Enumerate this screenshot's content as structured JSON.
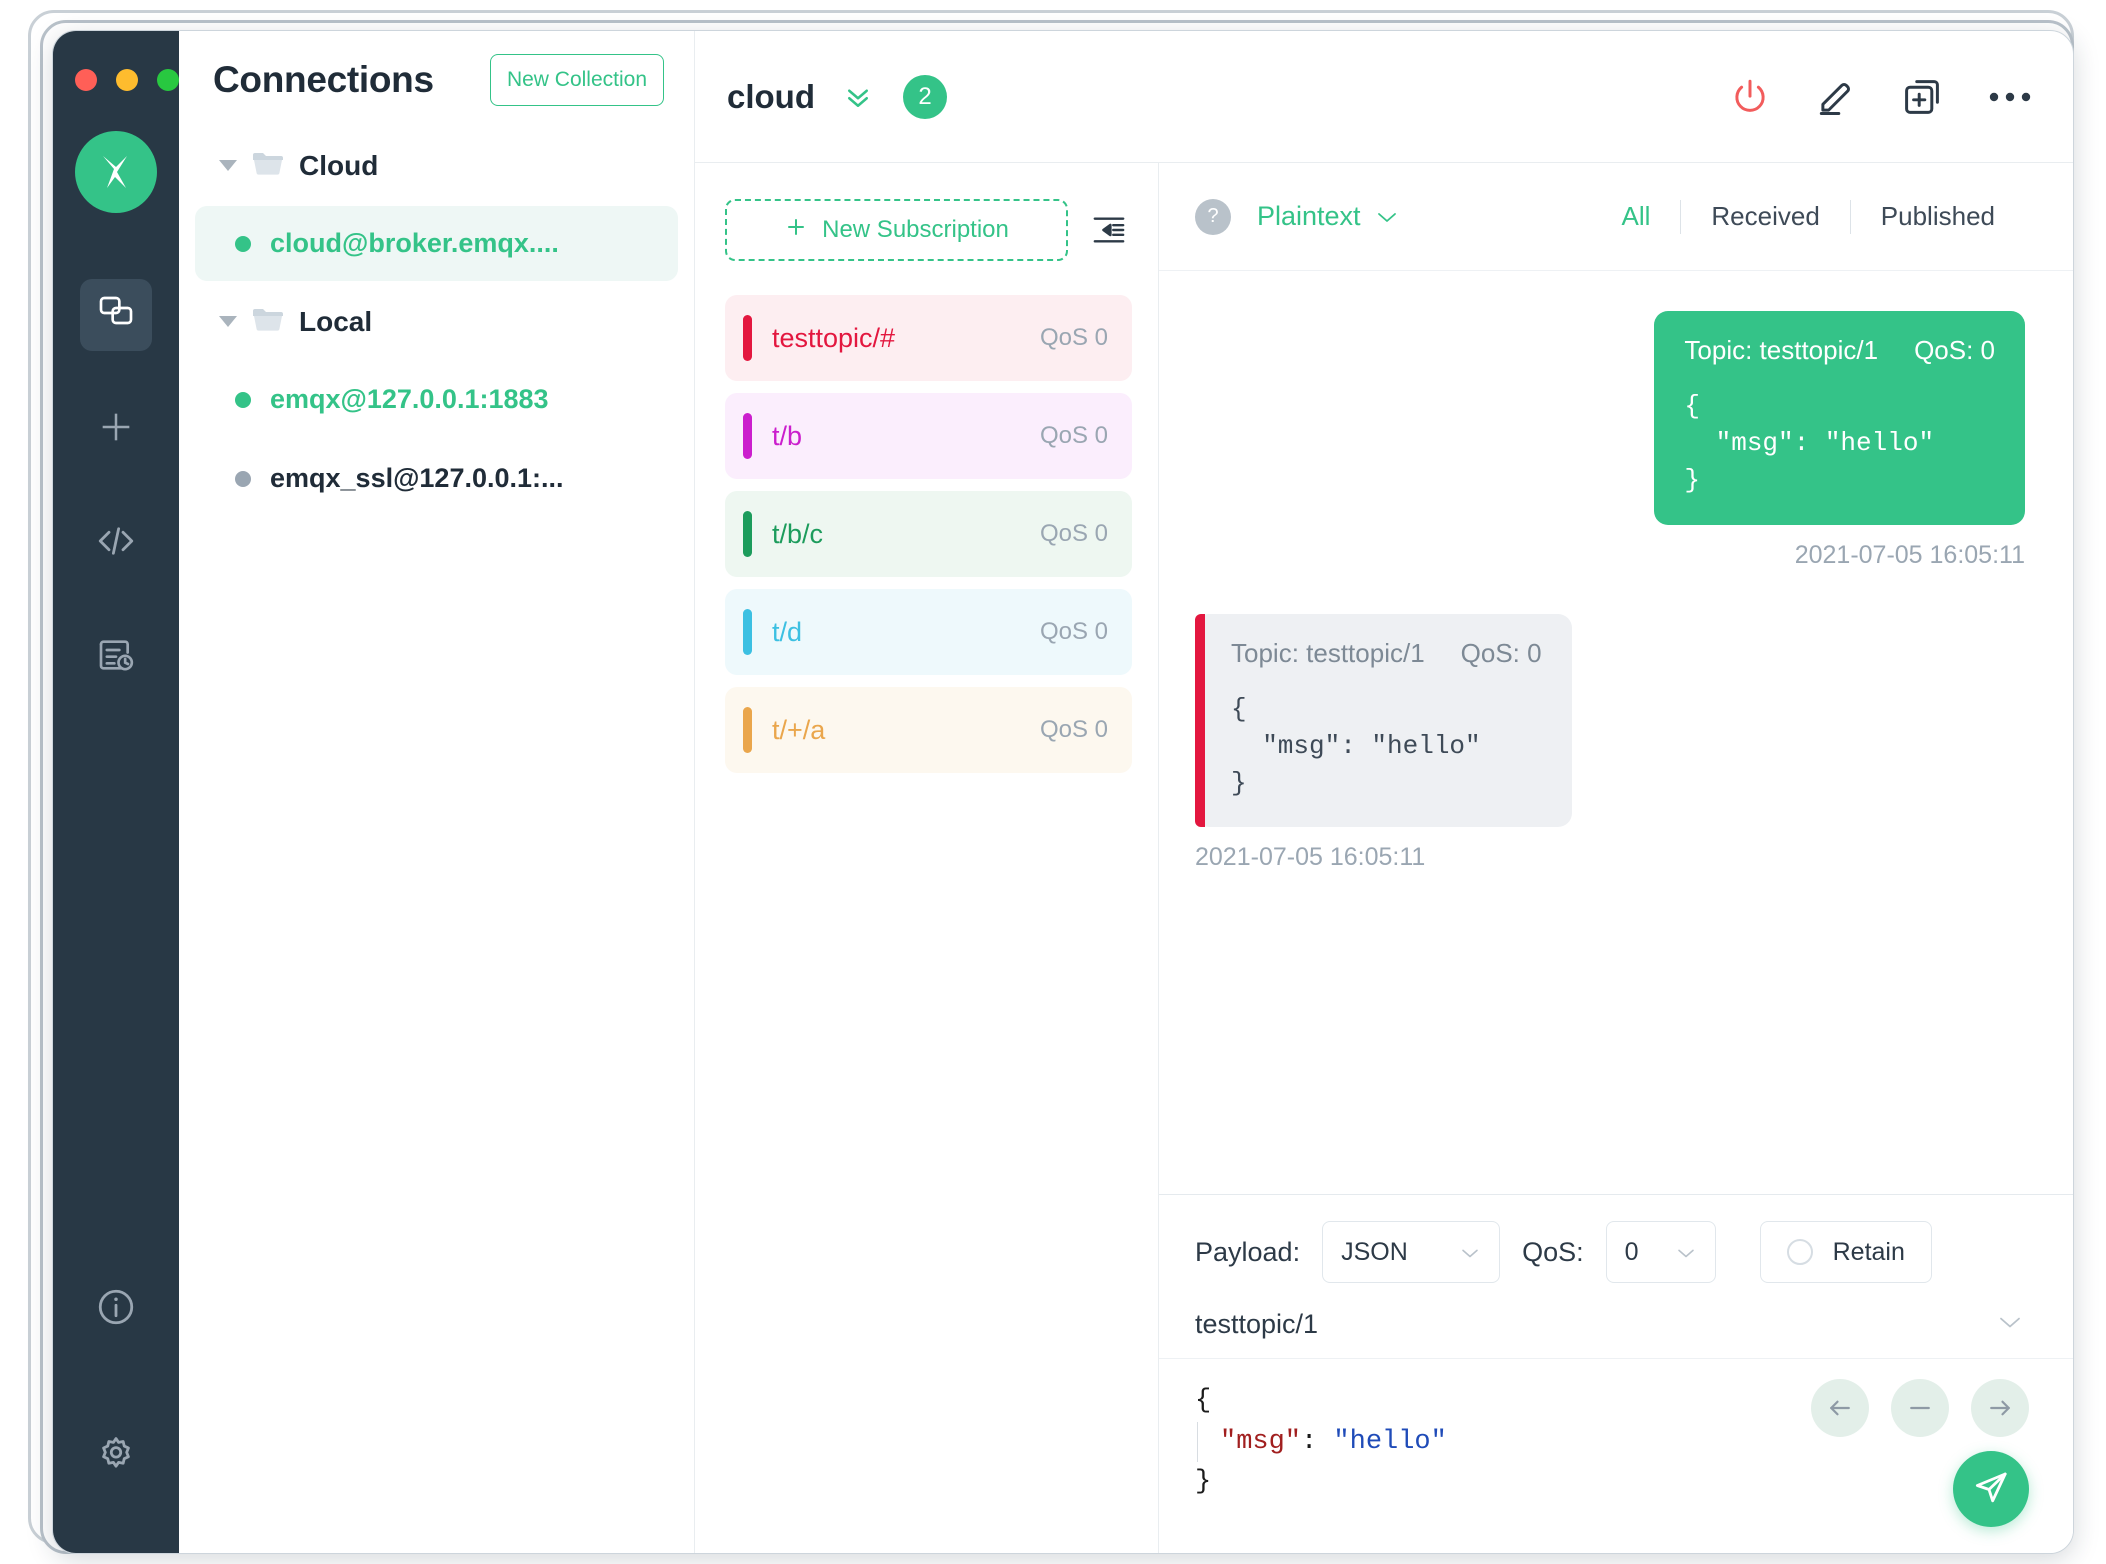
{
  "window": {
    "traffic_lights": [
      "close",
      "minimize",
      "maximize"
    ],
    "colors": {
      "accent_green": "#34c388",
      "rail_bg": "#283845",
      "danger_red": "#f25c5c"
    }
  },
  "rail": {
    "logo_label": "mqttx-logo",
    "items": [
      {
        "name": "connections-icon",
        "active": true
      },
      {
        "name": "new-connection-icon",
        "active": false
      },
      {
        "name": "script-code-icon",
        "active": false
      },
      {
        "name": "log-history-icon",
        "active": false
      }
    ],
    "bottom_items": [
      {
        "name": "about-info-icon"
      },
      {
        "name": "settings-gear-icon"
      }
    ]
  },
  "connections": {
    "title": "Connections",
    "new_collection_label": "New Collection",
    "groups": [
      {
        "name": "Cloud",
        "expanded": true,
        "items": [
          {
            "label": "cloud@broker.emqx....",
            "status": "connected",
            "selected": true
          }
        ]
      },
      {
        "name": "Local",
        "expanded": true,
        "items": [
          {
            "label": "emqx@127.0.0.1:1883",
            "status": "connected",
            "selected": false
          },
          {
            "label": "emqx_ssl@127.0.0.1:...",
            "status": "disconnected",
            "selected": false
          }
        ]
      }
    ]
  },
  "topbar": {
    "title": "cloud",
    "badge_count": "2",
    "icons": [
      {
        "name": "power-disconnect-icon",
        "color": "#f25c5c"
      },
      {
        "name": "edit-pencil-icon",
        "color": "#2d3a47"
      },
      {
        "name": "new-window-plus-icon",
        "color": "#2d3a47"
      },
      {
        "name": "more-options-icon",
        "color": "#2d3a47"
      }
    ]
  },
  "subscriptions": {
    "new_subscription_label": "New Subscription",
    "collapse_icon": "collapse-panel-icon",
    "items": [
      {
        "topic": "testtopic/#",
        "qos": "QoS 0",
        "color": "#e3173f",
        "bg": "#fdeef1"
      },
      {
        "topic": "t/b",
        "qos": "QoS 0",
        "color": "#cb1ecd",
        "bg": "#fbeefd"
      },
      {
        "topic": "t/b/c",
        "qos": "QoS 0",
        "color": "#1c9c5c",
        "bg": "#eef7f1"
      },
      {
        "topic": "t/d",
        "qos": "QoS 0",
        "color": "#3cc0e2",
        "bg": "#eef9fc"
      },
      {
        "topic": "t/+/a",
        "qos": "QoS 0",
        "color": "#eaa64c",
        "bg": "#fdf8ef"
      }
    ]
  },
  "messages_header": {
    "help_icon": "?",
    "format": "Plaintext",
    "filters": [
      {
        "label": "All",
        "active": true
      },
      {
        "label": "Received",
        "active": false
      },
      {
        "label": "Published",
        "active": false
      }
    ]
  },
  "messages": [
    {
      "direction": "published",
      "topic_label": "Topic: testtopic/1",
      "qos_label": "QoS: 0",
      "payload": "{\n  \"msg\": \"hello\"\n}",
      "time": "2021-07-05 16:05:11"
    },
    {
      "direction": "received",
      "topic_label": "Topic: testtopic/1",
      "qos_label": "QoS: 0",
      "payload": "{\n  \"msg\": \"hello\"\n}",
      "time": "2021-07-05 16:05:11",
      "bar_color": "#e3173f"
    }
  ],
  "publish": {
    "payload_label": "Payload:",
    "payload_value": "JSON",
    "qos_label": "QoS:",
    "qos_value": "0",
    "retain_label": "Retain",
    "retain_checked": false,
    "topic_value": "testtopic/1",
    "editor": {
      "line1": "{",
      "key": "\"msg\"",
      "colon": ": ",
      "value": "\"hello\"",
      "line3": "}"
    },
    "round_buttons": [
      {
        "name": "step-back-icon"
      },
      {
        "name": "collapse-minus-icon"
      },
      {
        "name": "step-forward-icon"
      }
    ],
    "send_button": "send-message-icon"
  }
}
